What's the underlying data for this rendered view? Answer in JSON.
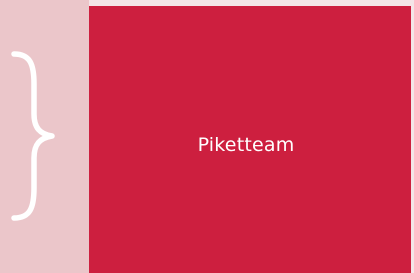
{
  "card": {
    "label": "Piketteam"
  },
  "colors": {
    "card_background": "#cd1f3f",
    "side_panel": "#ebc6ca",
    "card_text": "#ffffff",
    "brace": "#ffffff"
  },
  "icons": {
    "brace": "curly-brace-icon"
  }
}
